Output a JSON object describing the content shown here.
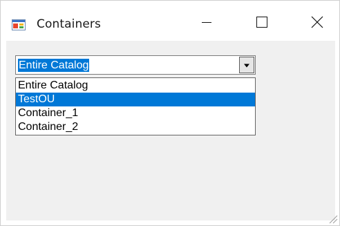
{
  "window": {
    "title": "Containers",
    "icon": "app-window-icon",
    "controls": [
      "minimize-icon",
      "maximize-icon",
      "close-icon"
    ]
  },
  "combo": {
    "value": "Entire Catalog",
    "arrow_icon": "dropdown-arrow-icon"
  },
  "dropdown": {
    "items": [
      {
        "label": "Entire Catalog",
        "selected": false
      },
      {
        "label": "TestOU",
        "selected": true
      },
      {
        "label": "Container_1",
        "selected": false
      },
      {
        "label": "Container_2",
        "selected": false
      }
    ]
  },
  "colors": {
    "selection": "#0078d7",
    "client_background": "#f0f0f0"
  }
}
